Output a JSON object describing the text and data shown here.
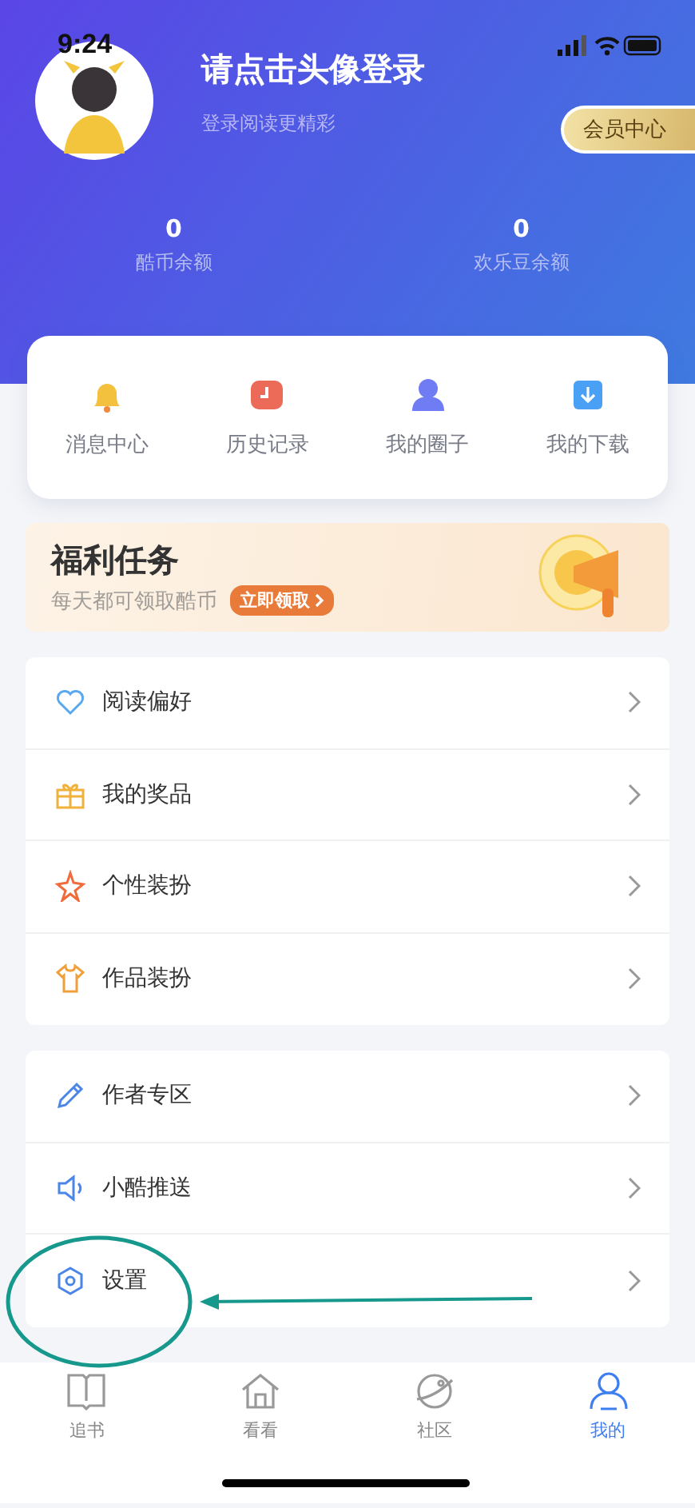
{
  "status_bar": {
    "time": "9:24"
  },
  "profile": {
    "title": "请点击头像登录",
    "subtitle": "登录阅读更精彩",
    "vip_button": "会员中心"
  },
  "balances": [
    {
      "value": "0",
      "label": "酷币余额"
    },
    {
      "value": "0",
      "label": "欢乐豆余额"
    }
  ],
  "shortcuts": [
    {
      "kind": "bell",
      "label": "消息中心"
    },
    {
      "kind": "history",
      "label": "历史记录"
    },
    {
      "kind": "circle",
      "label": "我的圈子"
    },
    {
      "kind": "download",
      "label": "我的下载"
    }
  ],
  "banner": {
    "title": "福利任务",
    "subtitle": "每天都可领取酷币",
    "button": "立即领取"
  },
  "menu_groups": [
    [
      {
        "kind": "heart",
        "label": "阅读偏好"
      },
      {
        "kind": "gift",
        "label": "我的奖品"
      },
      {
        "kind": "star",
        "label": "个性装扮"
      },
      {
        "kind": "shirt",
        "label": "作品装扮"
      }
    ],
    [
      {
        "kind": "pen",
        "label": "作者专区"
      },
      {
        "kind": "speaker",
        "label": "小酷推送"
      },
      {
        "kind": "gear",
        "label": "设置"
      }
    ]
  ],
  "tabs": [
    {
      "kind": "book",
      "label": "追书",
      "selected": false
    },
    {
      "kind": "home",
      "label": "看看",
      "selected": false
    },
    {
      "kind": "planet",
      "label": "社区",
      "selected": false
    },
    {
      "kind": "person",
      "label": "我的",
      "selected": true
    }
  ]
}
